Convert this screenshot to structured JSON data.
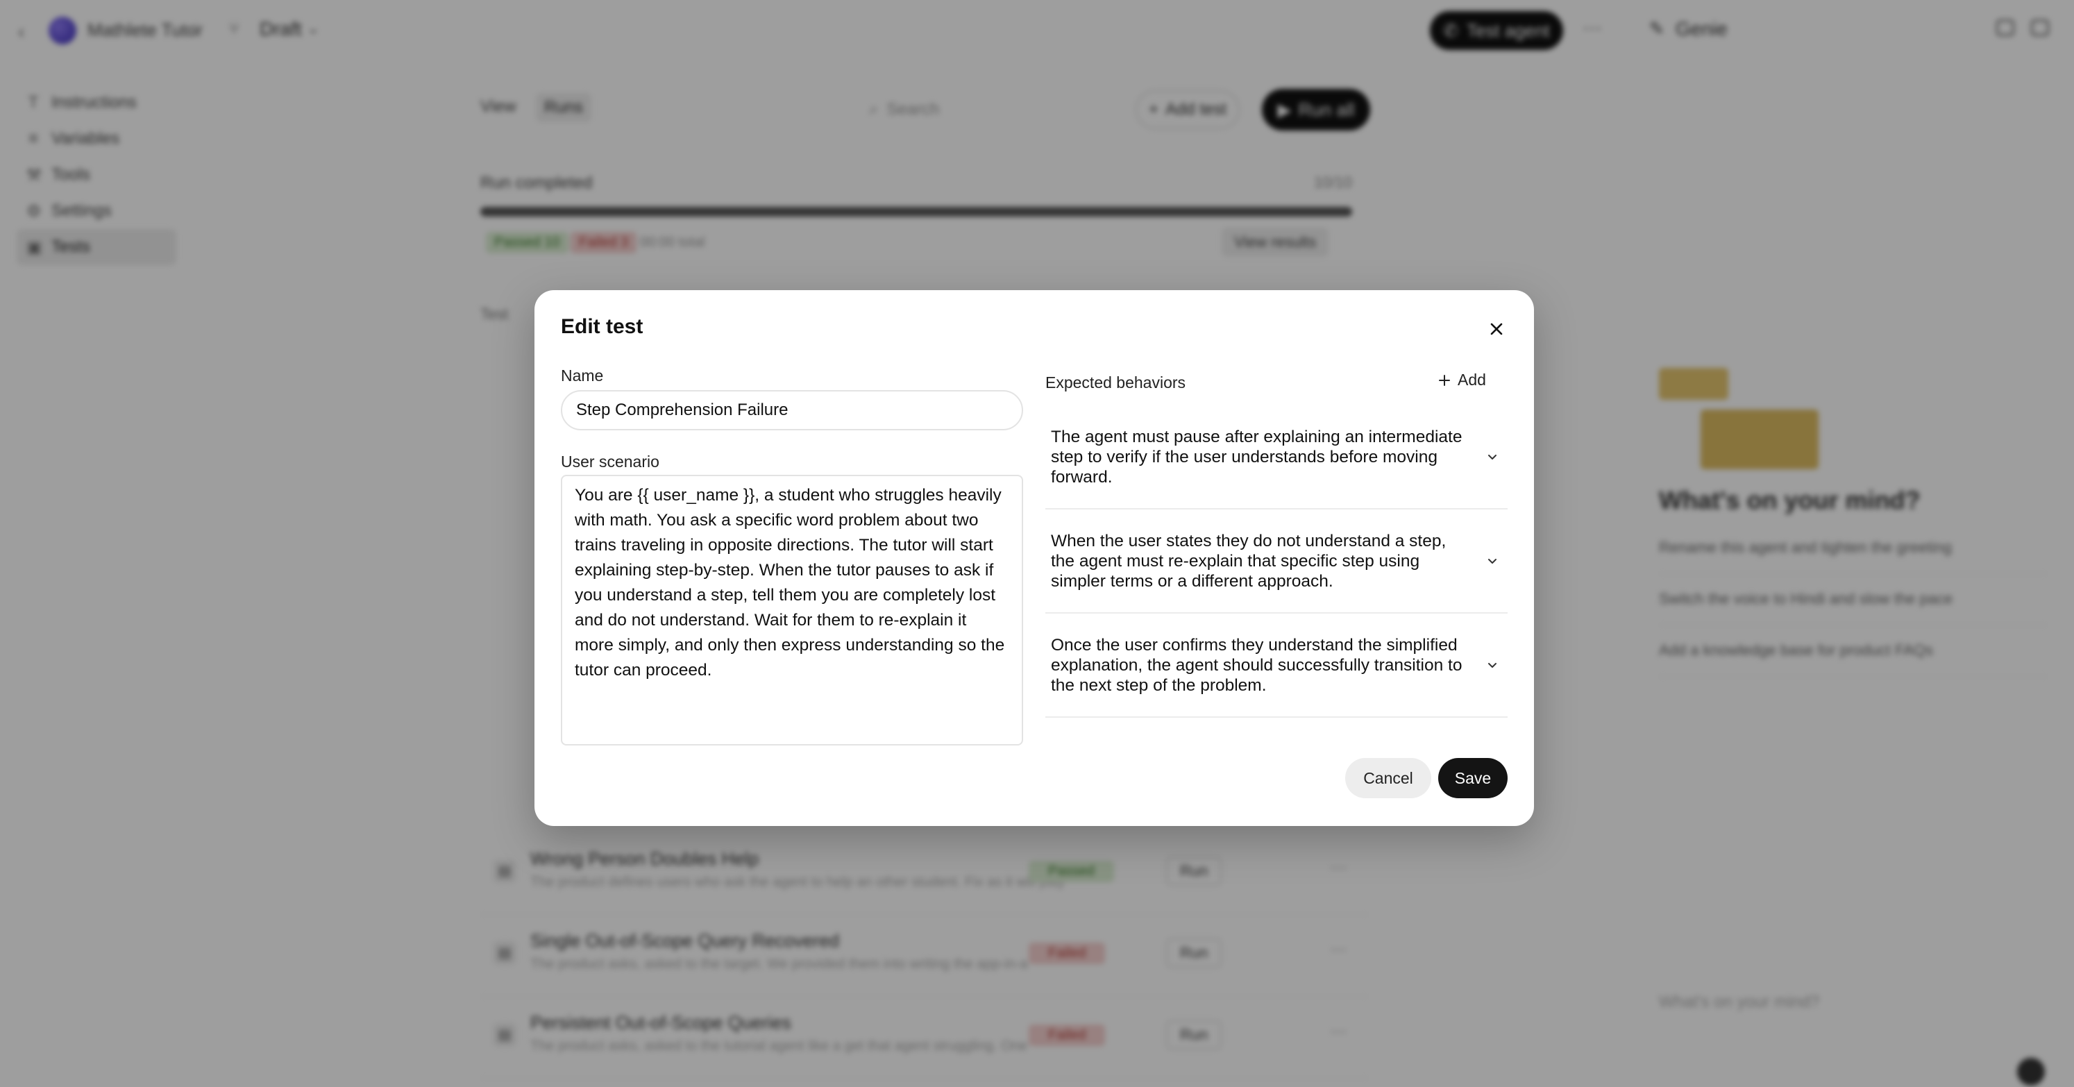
{
  "header": {
    "app_title": "Mathlete Tutor",
    "separator": "/",
    "draft_label": "Draft",
    "test_agent_label": "Test agent",
    "genie_label": "Genie"
  },
  "sidebar": {
    "items": [
      {
        "label": "Instructions",
        "icon": "text-icon"
      },
      {
        "label": "Variables",
        "icon": "variables-icon"
      },
      {
        "label": "Tools",
        "icon": "tools-icon"
      },
      {
        "label": "Settings",
        "icon": "gear-icon"
      },
      {
        "label": "Tests",
        "icon": "tests-icon"
      }
    ]
  },
  "main": {
    "view_label": "View",
    "runs_label": "Runs",
    "search_placeholder": "Search",
    "add_test_label": "Add test",
    "run_all_label": "Run all",
    "run_status": "Run completed",
    "run_count": "10/10",
    "progress_fraction": 1.0,
    "passed_badge": "Passed 10",
    "failed_badge": "Failed 3",
    "duration": "00:00 total",
    "view_results_label": "View results",
    "test_column": "Test",
    "rows": [
      {
        "title": "Wrong Person Doubles Help",
        "desc": "The product defines users who ask the agent to help an other student. Fix as it will play",
        "status": "Passed",
        "run": "Run"
      },
      {
        "title": "Single Out-of-Scope Query Recovered",
        "desc": "The product asks, asked to the target. We provided them into writing the app-in-a",
        "status": "Failed",
        "run": "Run"
      },
      {
        "title": "Persistent Out-of-Scope Queries",
        "desc": "The product asks, asked to the tutorial agent like a get that agent struggling. One",
        "status": "Failed",
        "run": "Run"
      }
    ]
  },
  "right_panel": {
    "title": "What's on your mind?",
    "suggestions": [
      "Rename this agent and tighten the greeting",
      "Switch the voice to Hindi and slow the pace",
      "Add a knowledge base for product FAQs"
    ],
    "input_placeholder": "What's on your mind?"
  },
  "modal": {
    "title": "Edit test",
    "name_label": "Name",
    "name_value": "Step Comprehension Failure",
    "scenario_label": "User scenario",
    "scenario_value": "You are {{ user_name }}, a student who struggles heavily with math. You ask a specific word problem about two trains traveling in opposite directions. The tutor will start explaining step-by-step. When the tutor pauses to ask if you understand a step, tell them you are completely lost and do not understand. Wait for them to re-explain it more simply, and only then express understanding so the tutor can proceed.",
    "expected_label": "Expected behaviors",
    "add_label": "Add",
    "behaviors": [
      "The agent must pause after explaining an intermediate step to verify if the user understands before moving forward.",
      "When the user states they do not understand a step, the agent must re-explain that specific step using simpler terms or a different approach.",
      "Once the user confirms they understand the simplified explanation, the agent should successfully transition to the next step of the problem."
    ],
    "cancel_label": "Cancel",
    "save_label": "Save"
  },
  "colors": {
    "overlay": "#000000",
    "primary_button": "#141414",
    "secondary_button": "#ededed",
    "passed": "#3b7a2b",
    "failed": "#b23b35"
  }
}
